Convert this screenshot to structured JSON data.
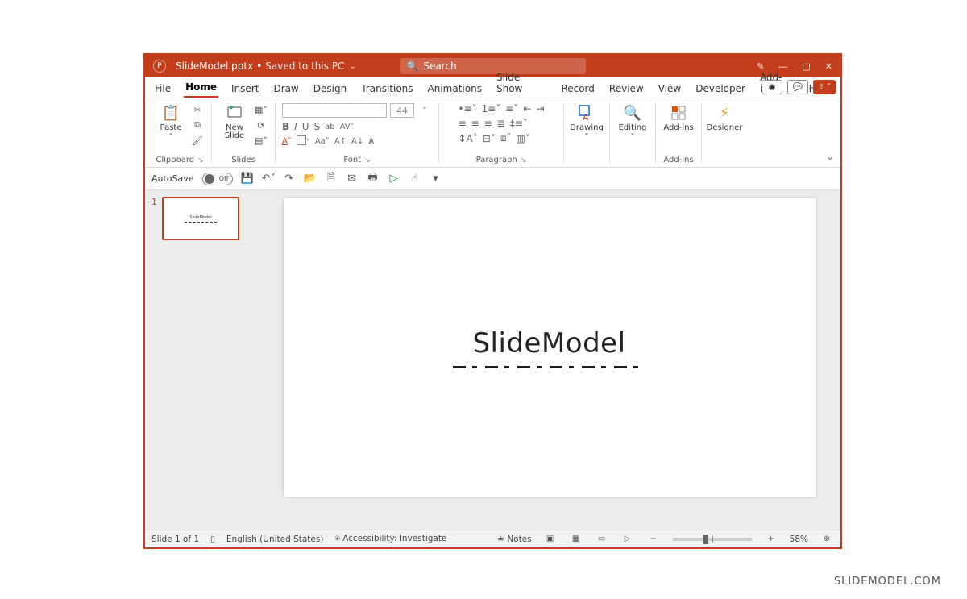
{
  "titlebar": {
    "filename": "SlideModel.pptx",
    "save_state": "Saved to this PC",
    "search_placeholder": "Search"
  },
  "tabs": [
    "File",
    "Home",
    "Insert",
    "Draw",
    "Design",
    "Transitions",
    "Animations",
    "Slide Show",
    "Record",
    "Review",
    "View",
    "Developer",
    "Add-ins",
    "Help"
  ],
  "active_tab": "Home",
  "ribbon": {
    "clipboard": {
      "paste": "Paste",
      "group": "Clipboard"
    },
    "slides": {
      "new_slide": "New\nSlide",
      "group": "Slides"
    },
    "font": {
      "size": "44",
      "group": "Font"
    },
    "paragraph": {
      "group": "Paragraph"
    },
    "drawing": {
      "label": "Drawing",
      "group": ""
    },
    "editing": {
      "label": "Editing"
    },
    "addins": {
      "label": "Add-ins",
      "group": "Add-ins"
    },
    "designer": {
      "label": "Designer"
    }
  },
  "qat": {
    "autosave": "AutoSave",
    "autosave_state": "Off"
  },
  "thumbnails": {
    "current": "1",
    "thumb_title": "SlideModel"
  },
  "slide": {
    "title": "SlideModel"
  },
  "status": {
    "slide_info": "Slide 1 of 1",
    "language": "English (United States)",
    "accessibility": "Accessibility: Investigate",
    "notes": "Notes",
    "zoom": "58%"
  },
  "watermark": "SLIDEMODEL.COM"
}
